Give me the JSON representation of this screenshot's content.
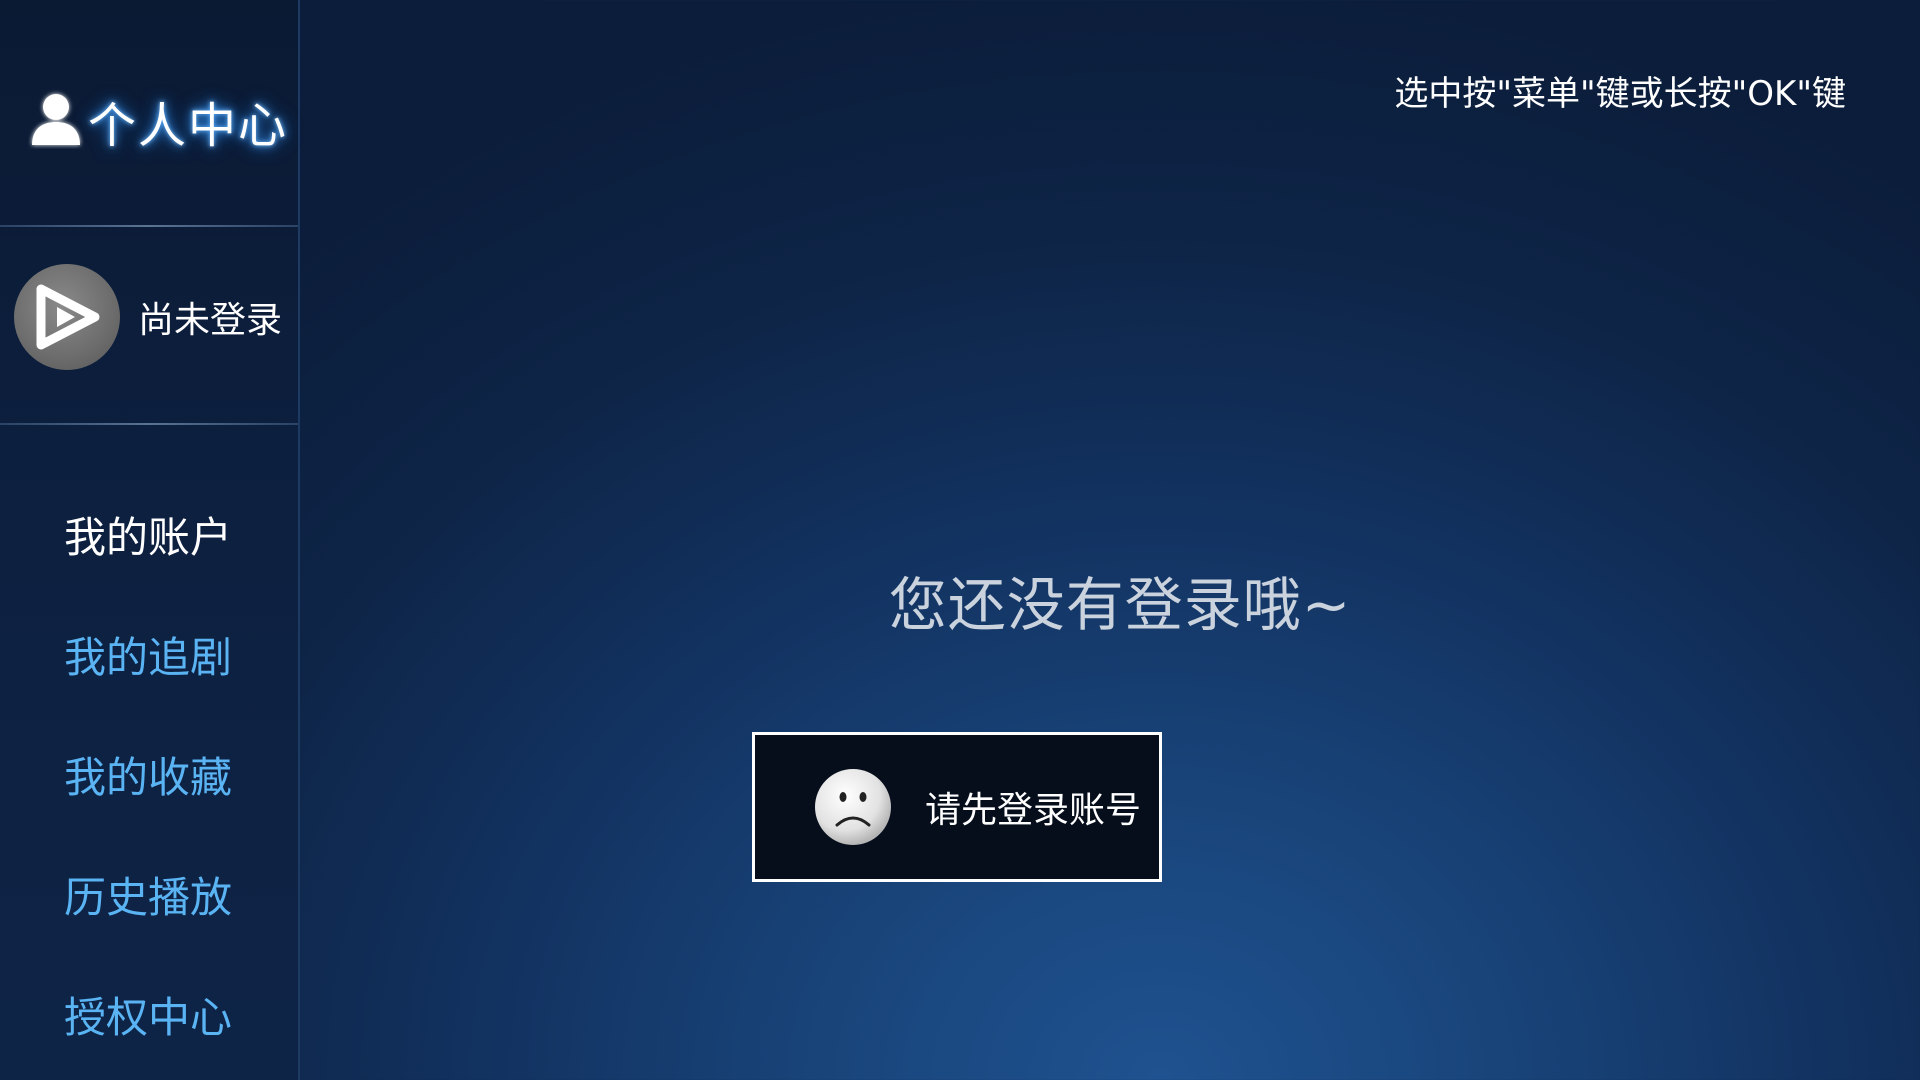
{
  "sidebar": {
    "title": "个人中心",
    "user_status": "尚未登录",
    "menu": [
      {
        "label": "我的账户",
        "active": true
      },
      {
        "label": "我的追剧",
        "active": false
      },
      {
        "label": "我的收藏",
        "active": false
      },
      {
        "label": "历史播放",
        "active": false
      },
      {
        "label": "授权中心",
        "active": false
      }
    ]
  },
  "header": {
    "hint": "选中按\"菜单\"键或长按\"OK\"键"
  },
  "main": {
    "empty_message": "您还没有登录哦~",
    "login_button_label": "请先登录账号"
  },
  "icons": {
    "brand": "user-icon",
    "avatar": "play-logo-icon",
    "login": "sad-face-icon"
  },
  "colors": {
    "accent_text": "#5ab4f4",
    "active_text": "#ffffff",
    "title_glow": "#3fa0ff",
    "background_dark": "#0b1d3a",
    "background_light": "#1f5290"
  }
}
